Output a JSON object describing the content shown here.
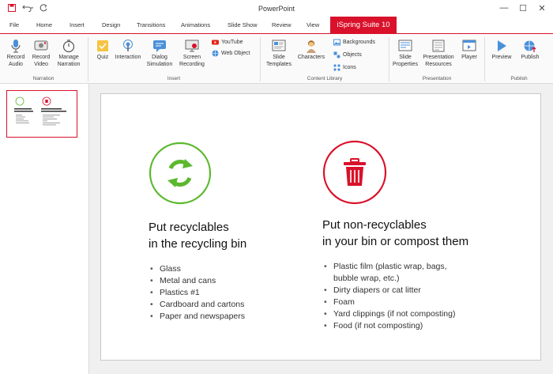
{
  "window": {
    "title": "PowerPoint"
  },
  "tabs": [
    "File",
    "Home",
    "Insert",
    "Design",
    "Transitions",
    "Animations",
    "Slide Show",
    "Review",
    "View"
  ],
  "active_tab": "iSpring Suite 10",
  "ribbon": {
    "narration": {
      "label": "Narration",
      "record_audio": "Record\nAudio",
      "record_video": "Record\nVideo",
      "manage_narration": "Manage\nNarration"
    },
    "insert": {
      "label": "Insert",
      "quiz": "Quiz",
      "interaction": "Interaction",
      "dialog_simulation": "Dialog\nSimulation",
      "screen_recording": "Screen\nRecording",
      "youtube": "YouTube",
      "web_object": "Web Object"
    },
    "content_library": {
      "label": "Content Library",
      "slide_templates": "Slide\nTemplates",
      "characters": "Characters",
      "backgrounds": "Backgrounds",
      "objects": "Objects",
      "icons": "Icons"
    },
    "presentation": {
      "label": "Presentation",
      "slide_properties": "Slide\nProperties",
      "presentation_resources": "Presentation\nResources",
      "player": "Player"
    },
    "publish": {
      "label": "Publish",
      "preview": "Preview",
      "publish": "Publish"
    }
  },
  "slide": {
    "left": {
      "heading_line1": "Put recyclables",
      "heading_line2": "in the recycling bin",
      "items": [
        "Glass",
        "Metal and cans",
        "Plastics #1",
        "Cardboard and cartons",
        "Paper and newspapers"
      ]
    },
    "right": {
      "heading_line1": "Put non-recyclables",
      "heading_line2": "in your bin or compost them",
      "items": [
        "Plastic film (plastic wrap, bags,",
        "bubble wrap, etc.)",
        "Dirty diapers or cat litter",
        "Foam",
        "Yard clippings (if not composting)",
        "Food (if not composting)"
      ]
    }
  },
  "colors": {
    "accent": "#d9112a",
    "recycle_green": "#5cb82e",
    "trash_red": "#d9112a"
  }
}
